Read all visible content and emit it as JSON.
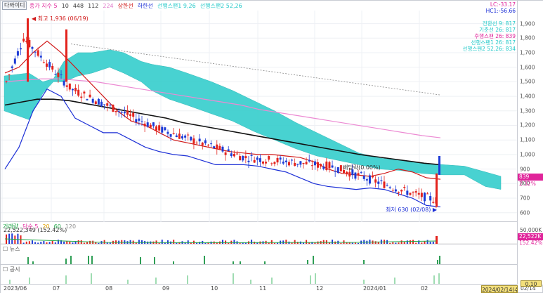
{
  "main": {
    "code_button": "다와이디",
    "legend": [
      {
        "text": "종가 지수 5",
        "color": "#e0249a"
      },
      {
        "text": "10",
        "color": "#3a3a3a"
      },
      {
        "text": "448",
        "color": "#3a3a3a"
      },
      {
        "text": "112",
        "color": "#3a3a3a"
      },
      {
        "text": "224",
        "color": "#e07acb"
      },
      {
        "text": "상한선",
        "color": "#d11a1a"
      },
      {
        "text": "하한선",
        "color": "#1c2fd6"
      },
      {
        "text": "선행스팬1 9,26",
        "color": "#23c9c9"
      },
      {
        "text": "선행스팬2 52,26",
        "color": "#23c9c9"
      }
    ],
    "right_legend": [
      {
        "text": "LC:-33.17",
        "color": "#e0249a"
      },
      {
        "text": "HC1:-56.66",
        "color": "#1c2fd6"
      }
    ],
    "ichimoku_values": [
      {
        "text": "전환선 9: 817",
        "color": "#23c9c9"
      },
      {
        "text": "기준선 26: 817",
        "color": "#23c9c9"
      },
      {
        "text": "후행스팬 26: 839",
        "color": "#e0249a"
      },
      {
        "text": "선행스팬1 26: 817",
        "color": "#23c9c9"
      },
      {
        "text": "선행스팬2 52,26: 834",
        "color": "#23c9c9"
      }
    ],
    "annotations": {
      "high": "최고 1,936 (06/19)",
      "low": "최저 630 (02/08)",
      "dividend": "배당락(0.00%)"
    },
    "price_axis": [
      "1,900",
      "1,800",
      "1,700",
      "1,600",
      "1,500",
      "1,400",
      "1,300",
      "1,200",
      "1,100",
      "1,000",
      "900",
      "800",
      "700",
      "600"
    ],
    "price_tags": [
      {
        "text": "839",
        "color": "#e0249a"
      },
      {
        "text": "2.32%",
        "color": "#e0249a"
      }
    ]
  },
  "volume": {
    "legend": [
      {
        "text": "거래량",
        "color": "#23a84a"
      },
      {
        "text": "단순 5",
        "color": "#e0249a"
      },
      {
        "text": "20",
        "color": "#e0a100"
      },
      {
        "text": "60",
        "color": "#23a84a"
      },
      {
        "text": "120",
        "color": "#8e8e8e"
      }
    ],
    "value_text": "22,522,349 (152.42%)",
    "axis": "50,000K",
    "tags": [
      {
        "text": "22,522K",
        "color": "#e0249a"
      },
      {
        "text": "152.42%",
        "color": "#e0249a"
      }
    ]
  },
  "news": {
    "label": "뉴스"
  },
  "disclosure": {
    "label": "공시"
  },
  "x_axis": [
    "2023/06",
    "07",
    "08",
    "09",
    "10",
    "11",
    "12",
    "2024/01",
    "02"
  ],
  "footer": {
    "zoom": "0.10",
    "date": "2024/02/14(수)",
    "date2": "02/14"
  },
  "chart_data": {
    "type": "candlestick",
    "title": "",
    "xlabel": "",
    "ylabel": "",
    "ylim": [
      560,
      1980
    ],
    "period": [
      "2023/06",
      "2024/02"
    ],
    "high_point": {
      "label": "최고 1,936",
      "date": "06/19",
      "value": 1936
    },
    "low_point": {
      "label": "최저 630",
      "date": "02/08",
      "value": 630
    },
    "last_close": 839,
    "change_pct": 2.32,
    "series": [
      {
        "name": "상한선",
        "values": [
          1560,
          1600,
          1700,
          1780,
          1700,
          1600,
          1500,
          1400,
          1300,
          1230,
          1200,
          1150,
          1100,
          1080,
          1060,
          1040,
          1020,
          1010,
          1000,
          1000,
          990,
          980,
          950,
          900,
          870,
          860,
          850,
          870,
          900,
          880,
          840,
          830
        ]
      },
      {
        "name": "하한선",
        "values": [
          900,
          1050,
          1300,
          1450,
          1400,
          1250,
          1200,
          1150,
          1150,
          1100,
          1050,
          1020,
          1000,
          990,
          960,
          930,
          930,
          930,
          920,
          900,
          880,
          840,
          800,
          780,
          770,
          760,
          770,
          760,
          730,
          700,
          650,
          640
        ]
      },
      {
        "name": "448",
        "values": [
          1340,
          1360,
          1380,
          1380,
          1370,
          1350,
          1330,
          1310,
          1290,
          1270,
          1250,
          1220,
          1200,
          1180,
          1160,
          1140,
          1120,
          1100,
          1080,
          1060,
          1040,
          1020,
          1000,
          985,
          970,
          955,
          940,
          930
        ]
      },
      {
        "name": "224",
        "values": [
          1500,
          1510,
          1520,
          1520,
          1510,
          1500,
          1480,
          1460,
          1440,
          1420,
          1400,
          1380,
          1360,
          1340,
          1310,
          1290,
          1270,
          1250,
          1230,
          1210,
          1190,
          1170,
          1150,
          1130,
          1115
        ]
      }
    ],
    "volume": {
      "last_value": 22522349,
      "last_pct": 152.42
    }
  }
}
